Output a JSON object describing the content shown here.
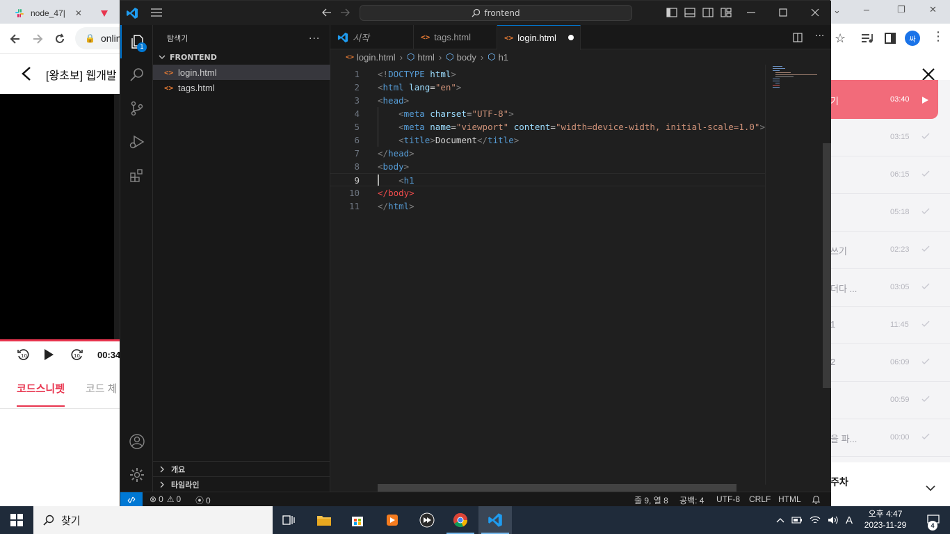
{
  "browser": {
    "tabs": [
      {
        "title": "node_47|"
      },
      {
        "title": "▹"
      }
    ],
    "url_partial": "onlin",
    "course_title": "[왕초보] 웹개발 ",
    "video_time": "00:34",
    "lower_tabs": [
      {
        "label": "코드스니펫"
      },
      {
        "label": "코드 체"
      }
    ],
    "profile_initial": "싸",
    "lessons": [
      {
        "title": "기",
        "time": "03:40"
      },
      {
        "title": "",
        "time": "03:15"
      },
      {
        "title": "",
        "time": "06:15"
      },
      {
        "title": "",
        "time": "05:18"
      },
      {
        "title": " 쓰기",
        "time": "02:23"
      },
      {
        "title": "더다 ...",
        "time": "03:05"
      },
      {
        "title": "1",
        "time": "11:45"
      },
      {
        "title": "2",
        "time": "06:09"
      },
      {
        "title": "",
        "time": "00:59"
      },
      {
        "title": "을 파...",
        "time": "00:00"
      }
    ],
    "week_label": "주차",
    "accent_color": "#e8344e"
  },
  "vscode": {
    "command_center": "frontend",
    "explorer_title": "탐색기",
    "explorer_more": "...",
    "folder_name": "FRONTEND",
    "files": [
      {
        "name": "login.html"
      },
      {
        "name": "tags.html"
      }
    ],
    "sections": [
      {
        "label": "개요"
      },
      {
        "label": "타임라인"
      }
    ],
    "badge_count": "1",
    "tabs": [
      {
        "label": "시작"
      },
      {
        "label": "tags.html"
      },
      {
        "label": "login.html"
      }
    ],
    "breadcrumb": [
      "login.html",
      "html",
      "body",
      "h1"
    ],
    "code_lines": [
      {
        "n": "1",
        "parts": [
          [
            "t",
            "<!"
          ],
          [
            "tag",
            "DOCTYPE"
          ],
          [
            "txt",
            " "
          ],
          [
            "attr",
            "html"
          ],
          [
            "t",
            ">"
          ]
        ]
      },
      {
        "n": "2",
        "parts": [
          [
            "t",
            "<"
          ],
          [
            "tag",
            "html"
          ],
          [
            "txt",
            " "
          ],
          [
            "attr",
            "lang"
          ],
          [
            "txt",
            "="
          ],
          [
            "str",
            "\"en\""
          ],
          [
            "t",
            ">"
          ]
        ]
      },
      {
        "n": "3",
        "parts": [
          [
            "t",
            "<"
          ],
          [
            "tag",
            "head"
          ],
          [
            "t",
            ">"
          ]
        ]
      },
      {
        "n": "4",
        "parts": [
          [
            "txt",
            "    "
          ],
          [
            "t",
            "<"
          ],
          [
            "tag",
            "meta"
          ],
          [
            "txt",
            " "
          ],
          [
            "attr",
            "charset"
          ],
          [
            "txt",
            "="
          ],
          [
            "str",
            "\"UTF-8\""
          ],
          [
            "t",
            ">"
          ]
        ]
      },
      {
        "n": "5",
        "parts": [
          [
            "txt",
            "    "
          ],
          [
            "t",
            "<"
          ],
          [
            "tag",
            "meta"
          ],
          [
            "txt",
            " "
          ],
          [
            "attr",
            "name"
          ],
          [
            "txt",
            "="
          ],
          [
            "str",
            "\"viewport\""
          ],
          [
            "txt",
            " "
          ],
          [
            "attr",
            "content"
          ],
          [
            "txt",
            "="
          ],
          [
            "str",
            "\"width=device-width, initial-scale=1.0\""
          ],
          [
            "t",
            ">"
          ]
        ]
      },
      {
        "n": "6",
        "parts": [
          [
            "txt",
            "    "
          ],
          [
            "t",
            "<"
          ],
          [
            "tag",
            "title"
          ],
          [
            "t",
            ">"
          ],
          [
            "txt",
            "Document"
          ],
          [
            "t",
            "</"
          ],
          [
            "tag",
            "title"
          ],
          [
            "t",
            ">"
          ]
        ]
      },
      {
        "n": "7",
        "parts": [
          [
            "t",
            "</"
          ],
          [
            "tag",
            "head"
          ],
          [
            "t",
            ">"
          ]
        ]
      },
      {
        "n": "8",
        "parts": [
          [
            "t",
            "<"
          ],
          [
            "tag",
            "body"
          ],
          [
            "t",
            ">"
          ]
        ]
      },
      {
        "n": "9",
        "parts": [
          [
            "txt",
            "    "
          ],
          [
            "t",
            "<"
          ],
          [
            "tag",
            "h1"
          ]
        ]
      },
      {
        "n": "10",
        "parts": [
          [
            "err",
            "</"
          ],
          [
            "err",
            "body"
          ],
          [
            "err",
            ">"
          ]
        ]
      },
      {
        "n": "11",
        "parts": [
          [
            "t",
            "</"
          ],
          [
            "tag",
            "html"
          ],
          [
            "t",
            ">"
          ]
        ]
      }
    ],
    "status": {
      "errors": "0",
      "warnings": "0",
      "ports": "0",
      "position": "줄 9, 열 8",
      "indent": "공백: 4",
      "encoding": "UTF-8",
      "eol": "CRLF",
      "language": "HTML"
    }
  },
  "taskbar": {
    "search_label": "찾기",
    "time": "오후 4:47",
    "date": "2023-11-29",
    "ime": "A",
    "notification_count": "4"
  }
}
